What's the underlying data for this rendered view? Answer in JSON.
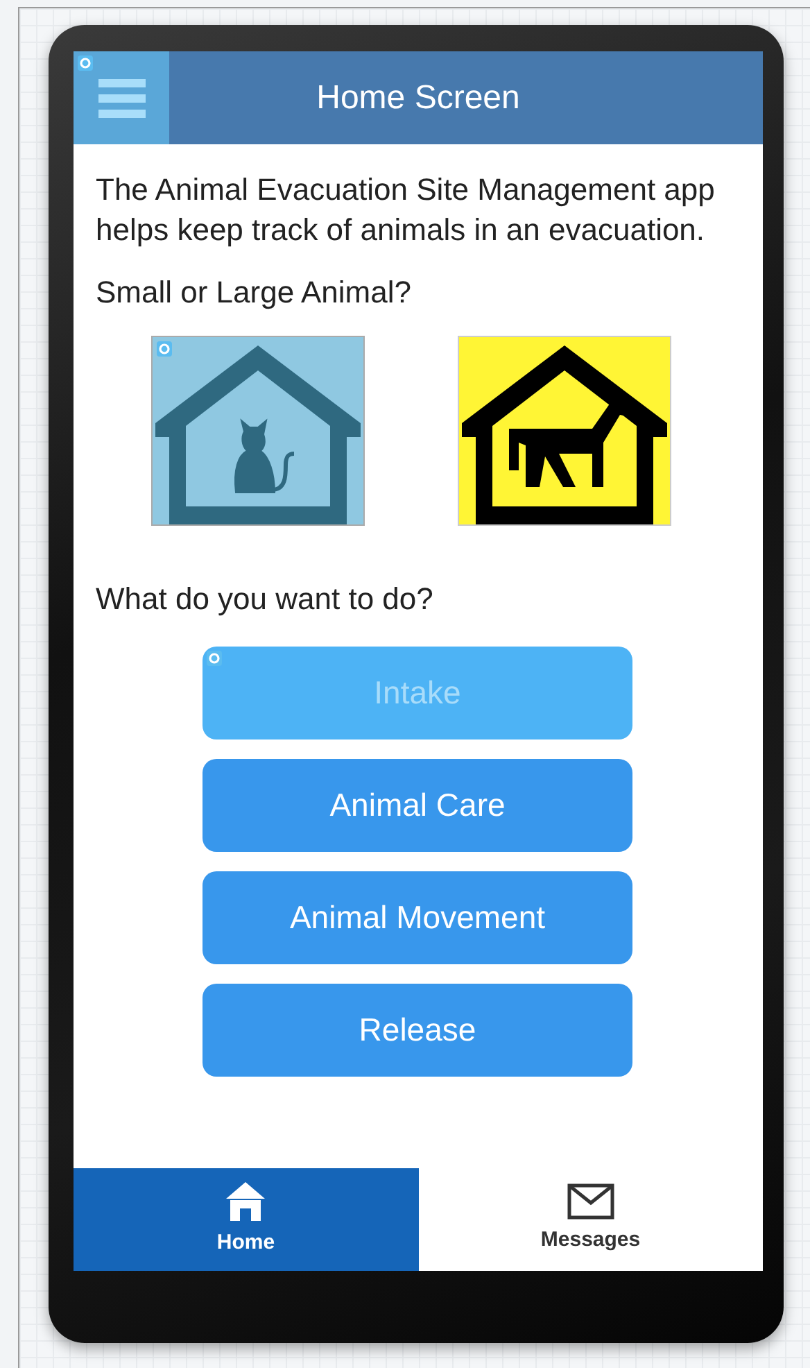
{
  "header": {
    "title": "Home Screen",
    "menu_selected": true
  },
  "intro": "The Animal Evacuation Site Management app helps keep track of animals in an evacuation.",
  "animal_question": "Small or Large Animal?",
  "animals": [
    {
      "kind": "cat",
      "selected": true
    },
    {
      "kind": "horse",
      "selected": false
    }
  ],
  "action_question": "What do you want to do?",
  "actions": [
    {
      "label": "Intake",
      "selected": true
    },
    {
      "label": "Animal Care",
      "selected": false
    },
    {
      "label": "Animal Movement",
      "selected": false
    },
    {
      "label": "Release",
      "selected": false
    }
  ],
  "tabs": [
    {
      "label": "Home",
      "kind": "home",
      "selected": true
    },
    {
      "label": "Messages",
      "kind": "mail",
      "selected": false
    }
  ]
}
